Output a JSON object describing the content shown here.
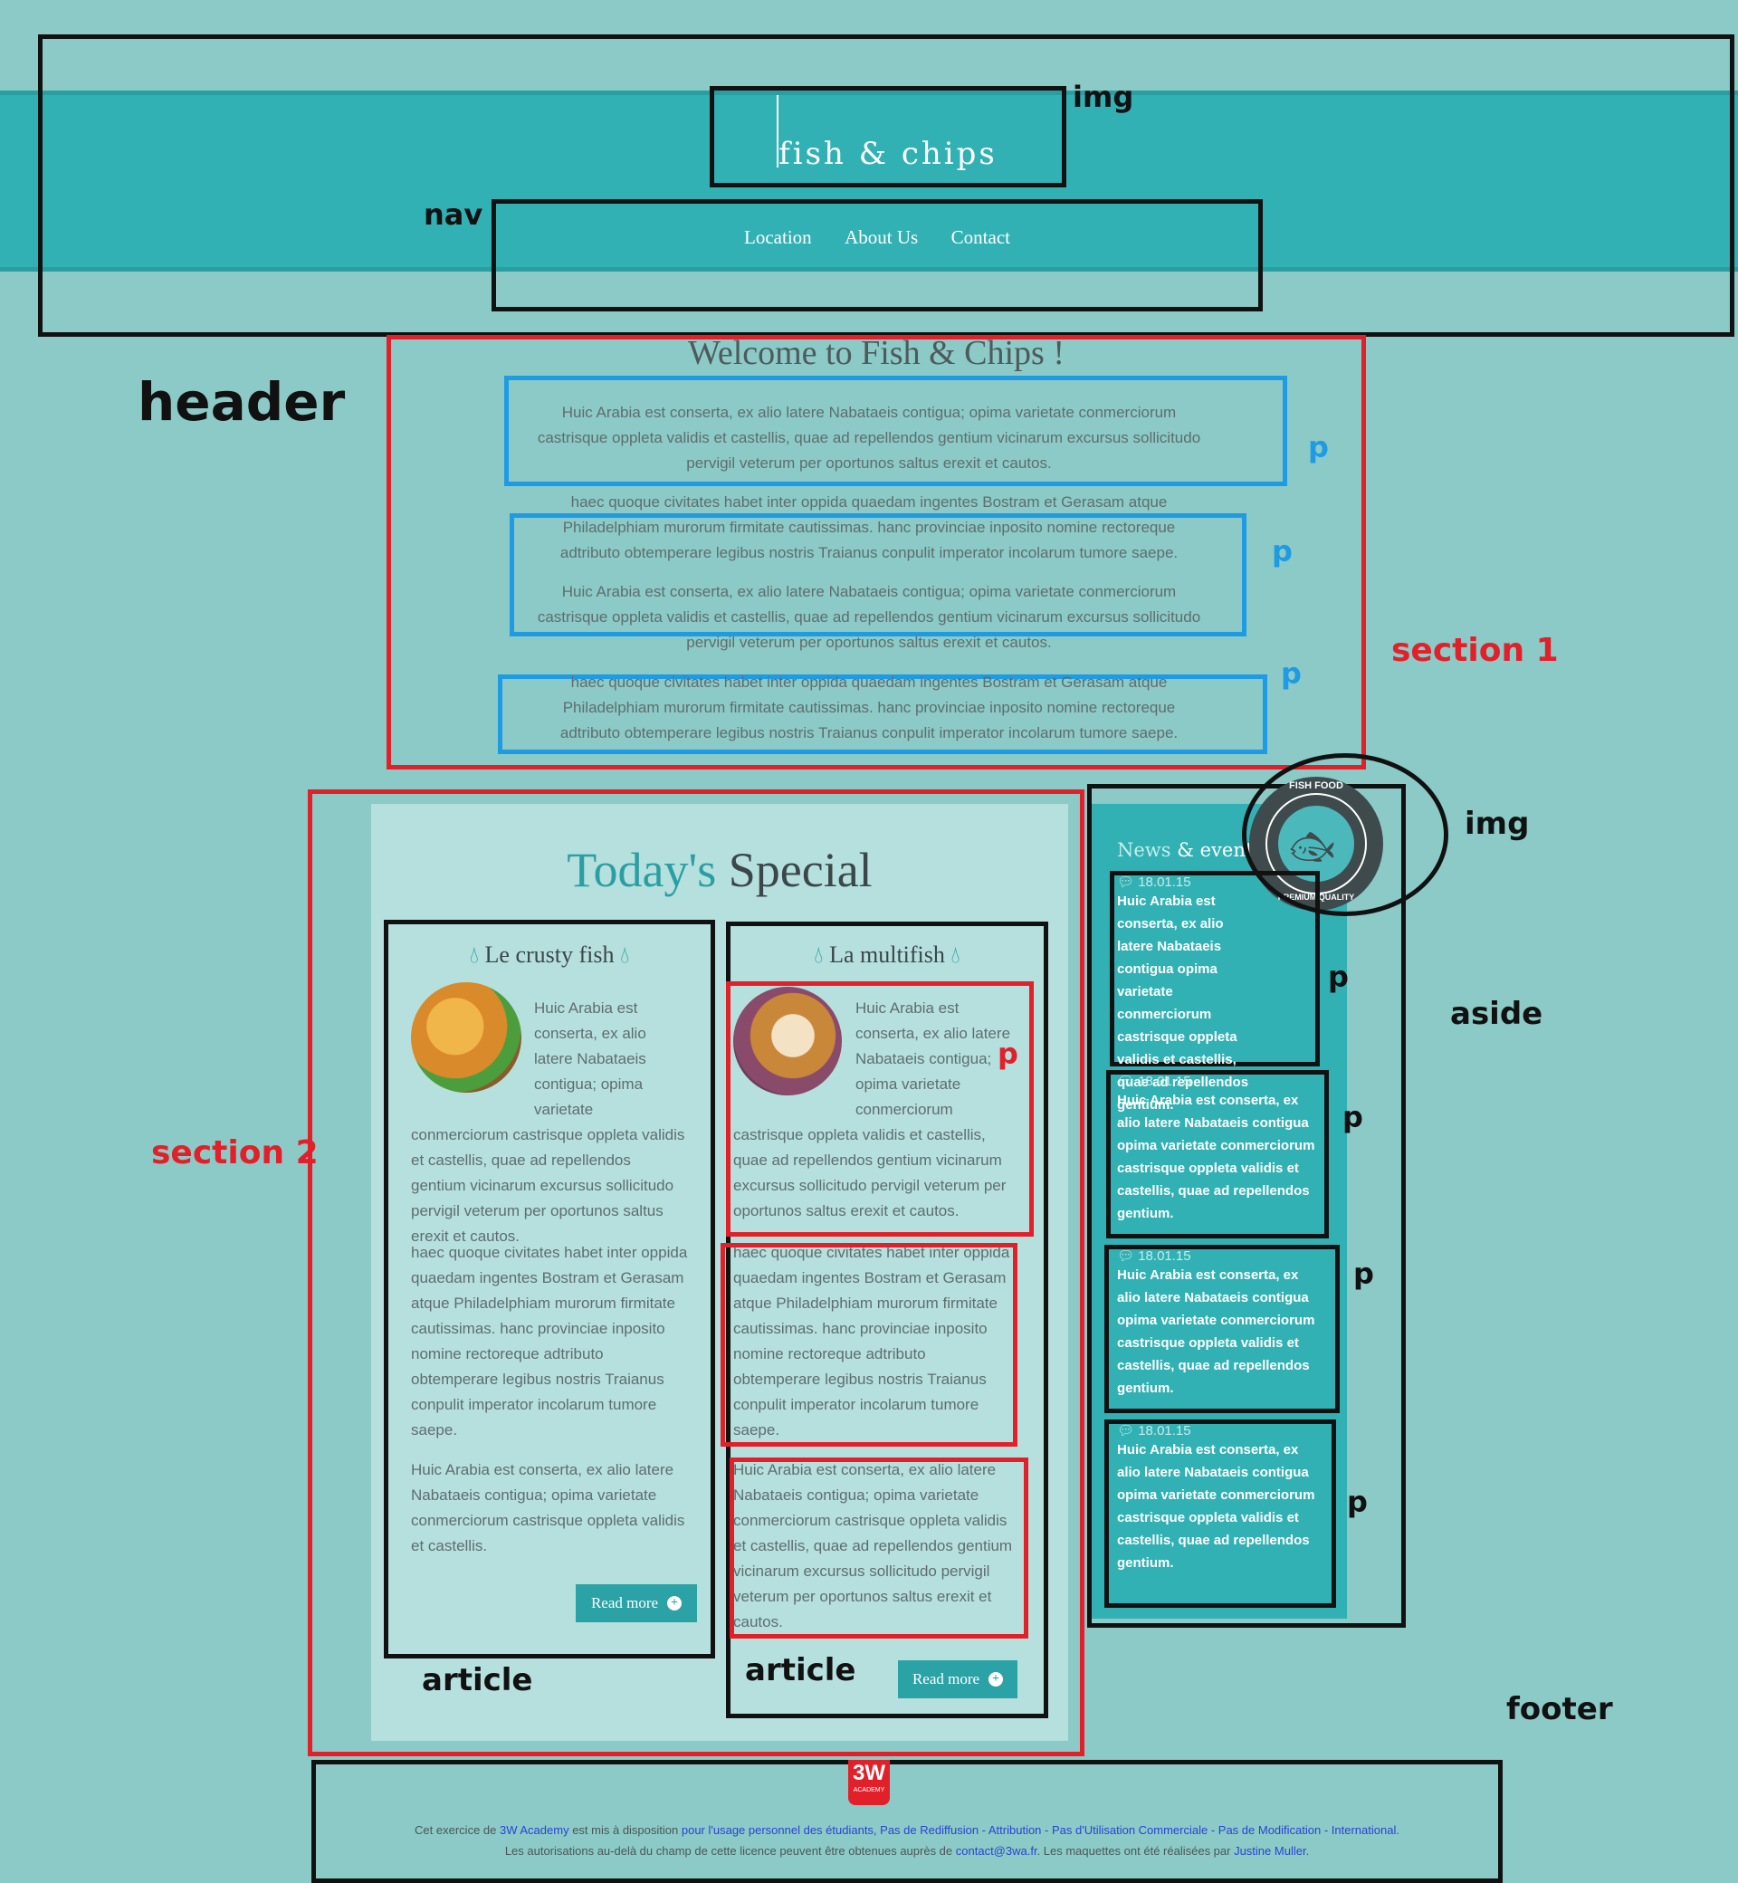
{
  "header": {
    "logo_text": "fish & chips",
    "nav": [
      "Location",
      "About Us",
      "Contact"
    ]
  },
  "annotations": {
    "img1": "img",
    "nav": "nav",
    "header": "header",
    "p": "p",
    "section1": "section 1",
    "section2": "section 2",
    "img2": "img",
    "aside": "aside",
    "article1": "article",
    "article2": "article",
    "footer": "footer"
  },
  "section1": {
    "title": "Welcome to Fish & Chips !",
    "para_a": "Huic Arabia est conserta, ex alio latere Nabataeis contigua; opima varietate conmerciorum castrisque oppleta validis et castellis, quae ad repellendos gentium vicinarum excursus sollicitudo pervigil veterum per oportunos saltus erexit et cautos.",
    "para_b": "haec quoque civitates habet inter oppida quaedam ingentes Bostram et Gerasam atque Philadelphiam murorum firmitate cautissimas. hanc provinciae inposito nomine rectoreque adtributo obtemperare legibus nostris Traianus conpulit imperator incolarum tumore saepe."
  },
  "section2": {
    "title_part1": "Today's",
    "title_part2": "Special",
    "articles": [
      {
        "title": "Le crusty fish",
        "p1": "Huic Arabia est conserta, ex alio latere Nabataeis contigua; opima varietate conmerciorum castrisque oppleta validis et castellis, quae ad repellendos gentium vicinarum excursus sollicitudo pervigil veterum per oportunos saltus erexit et cautos.",
        "p2": "haec quoque civitates habet inter oppida quaedam ingentes Bostram et Gerasam atque Philadelphiam murorum firmitate cautissimas. hanc provinciae inposito nomine rectoreque adtributo obtemperare legibus nostris Traianus conpulit imperator incolarum tumore saepe.",
        "p3": "Huic Arabia est conserta, ex alio latere Nabataeis contigua; opima varietate conmerciorum castrisque oppleta validis et castellis.",
        "button": "Read more"
      },
      {
        "title": "La multifish",
        "p1": "Huic Arabia est conserta, ex alio latere Nabataeis contigua; opima varietate conmerciorum castrisque oppleta validis et castellis, quae ad repellendos gentium vicinarum excursus sollicitudo pervigil veterum per oportunos saltus erexit et cautos.",
        "p2": "haec quoque civitates habet inter oppida quaedam ingentes Bostram et Gerasam atque Philadelphiam murorum firmitate cautissimas. hanc provinciae inposito nomine rectoreque adtributo obtemperare legibus nostris Traianus conpulit imperator incolarum tumore saepe.",
        "p3": "Huic Arabia est conserta, ex alio latere Nabataeis contigua; opima varietate conmerciorum castrisque oppleta validis et castellis, quae ad repellendos gentium vicinarum excursus sollicitudo pervigil veterum per oportunos saltus erexit et cautos.",
        "button": "Read more"
      }
    ]
  },
  "aside": {
    "title_part1": "News",
    "title_part2": "& events",
    "badge_top": "FISH FOOD",
    "badge_bottom": "PREMIUM QUALITY",
    "items": [
      {
        "date": "18.01.15",
        "text": "Huic Arabia est conserta, ex alio latere Nabataeis contigua opima varietate conmerciorum castrisque oppleta validis et castellis, quae ad repellendos gentium."
      },
      {
        "date": "18.01.15",
        "text": "Huic Arabia est conserta, ex alio latere Nabataeis contigua opima varietate conmerciorum castrisque oppleta validis et castellis, quae ad repellendos gentium."
      },
      {
        "date": "18.01.15",
        "text": "Huic Arabia est conserta, ex alio latere Nabataeis contigua opima varietate conmerciorum castrisque oppleta validis et castellis, quae ad repellendos gentium."
      },
      {
        "date": "18.01.15",
        "text": "Huic Arabia est conserta, ex alio latere Nabataeis contigua opima varietate conmerciorum castrisque oppleta validis et castellis, quae ad repellendos gentium."
      }
    ]
  },
  "footer": {
    "logo": "3W",
    "logo_sub": "ACADEMY",
    "line1_a": "Cet exercice de ",
    "line1_link1": "3W Academy",
    "line1_b": " est mis à disposition ",
    "line1_link2": "pour l'usage personnel des étudiants, Pas de Rediffusion - Attribution - Pas d'Utilisation Commerciale - Pas de Modification - International.",
    "line2_a": "Les autorisations au-delà du champ de cette licence peuvent être obtenues auprès de ",
    "line2_link1": "contact@3wa.fr",
    "line2_b": ". Les maquettes ont été réalisées par ",
    "line2_link2": "Justine Muller",
    "line2_c": "."
  }
}
